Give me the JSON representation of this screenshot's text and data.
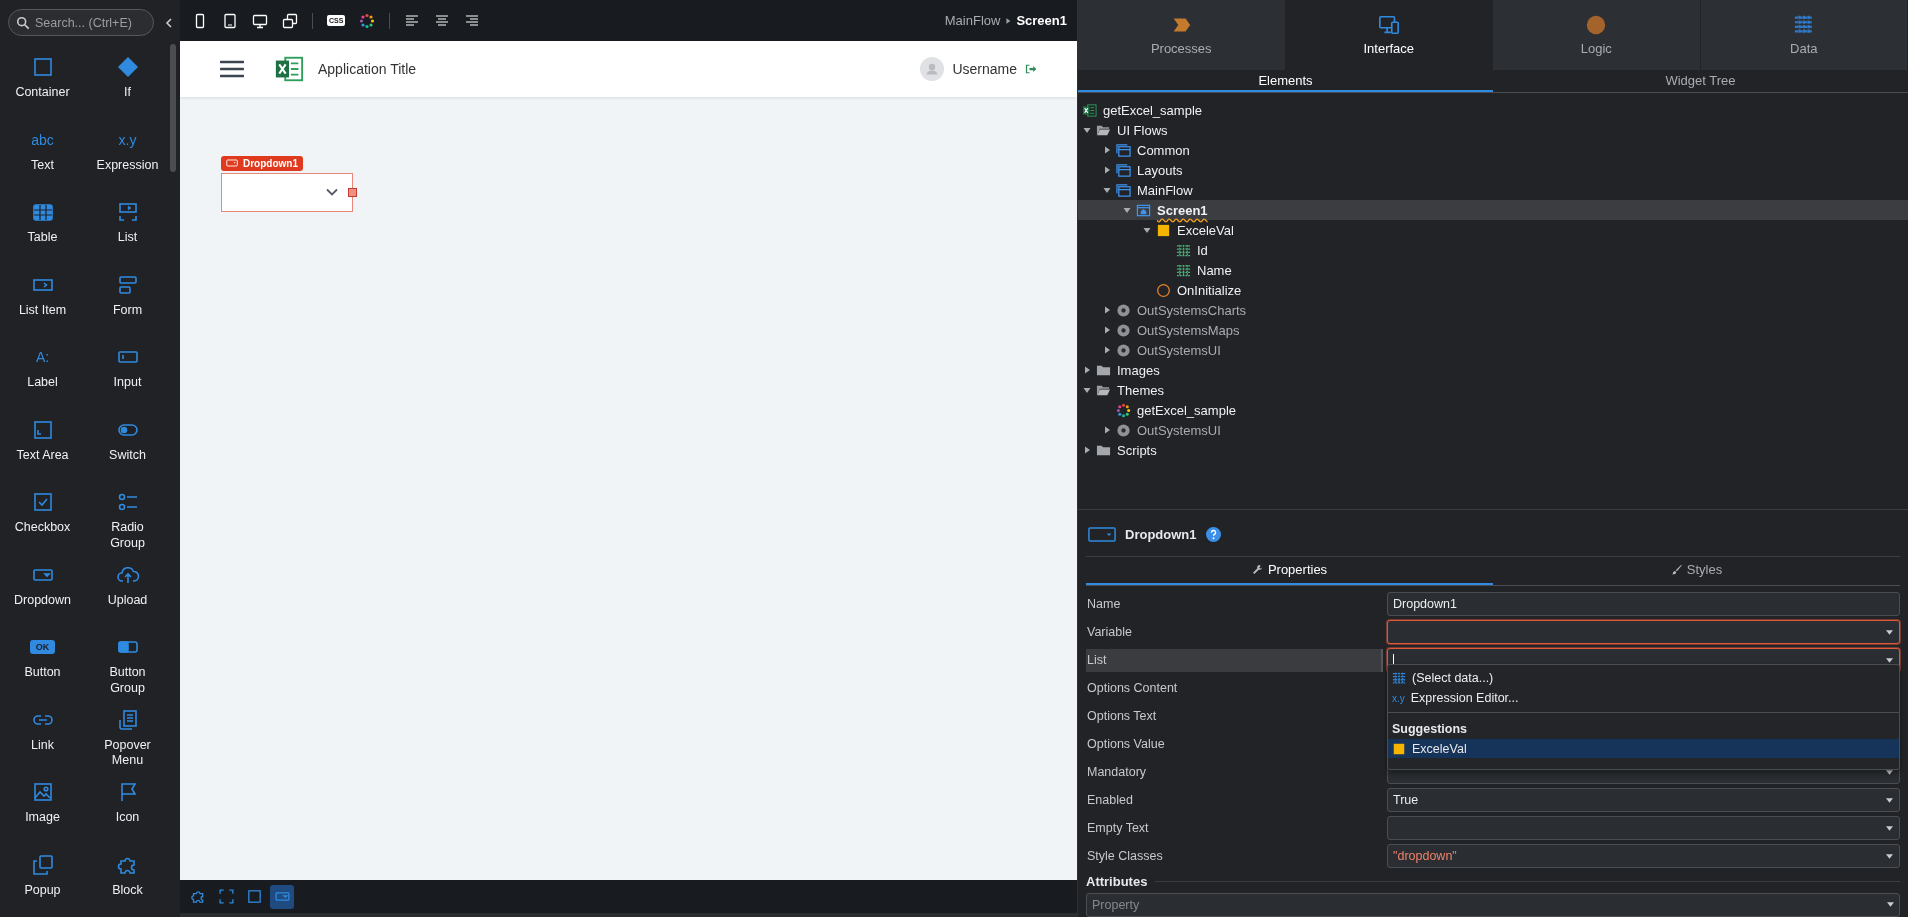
{
  "toolbox": {
    "search": {
      "placeholder": "Search... (Ctrl+E)"
    },
    "items": [
      {
        "kind": "container",
        "label": "Container"
      },
      {
        "kind": "if",
        "label": "If"
      },
      {
        "kind": "glyph",
        "glyph": "abc",
        "label": "Text"
      },
      {
        "kind": "glyph",
        "glyph": "x.y",
        "label": "Expression"
      },
      {
        "kind": "table",
        "label": "Table"
      },
      {
        "kind": "list",
        "label": "List"
      },
      {
        "kind": "list_item",
        "label": "List Item"
      },
      {
        "kind": "form",
        "label": "Form"
      },
      {
        "kind": "glyph",
        "glyph": "A:",
        "label": "Label"
      },
      {
        "kind": "input",
        "label": "Input"
      },
      {
        "kind": "text_area",
        "label": "Text Area"
      },
      {
        "kind": "switch",
        "label": "Switch"
      },
      {
        "kind": "checkbox",
        "label": "Checkbox"
      },
      {
        "kind": "radio_group",
        "label": "Radio Group"
      },
      {
        "kind": "dropdown",
        "label": "Dropdown"
      },
      {
        "kind": "upload",
        "label": "Upload"
      },
      {
        "kind": "button",
        "glyph": "OK",
        "label": "Button"
      },
      {
        "kind": "button_group",
        "label": "Button Group"
      },
      {
        "kind": "link",
        "label": "Link"
      },
      {
        "kind": "popover_menu",
        "label": "Popover Menu"
      },
      {
        "kind": "image",
        "label": "Image"
      },
      {
        "kind": "icon",
        "label": "Icon"
      },
      {
        "kind": "popup",
        "label": "Popup"
      },
      {
        "kind": "block",
        "label": "Block"
      }
    ]
  },
  "canvas": {
    "toolbar": {
      "css_glyph": "CSS"
    },
    "breadcrumb": [
      "MainFlow",
      "Screen1"
    ],
    "app": {
      "title": "Application Title",
      "username": "Username",
      "widget_tag": "Dropdown1"
    },
    "bottom_tools": [
      {
        "selected": false
      },
      {
        "selected": false
      },
      {
        "selected": false
      },
      {
        "selected": true
      }
    ]
  },
  "tabs": [
    {
      "label": "Processes",
      "kind": "processes",
      "selected": false
    },
    {
      "label": "Interface",
      "kind": "interface",
      "selected": true
    },
    {
      "label": "Logic",
      "kind": "logic",
      "selected": false
    },
    {
      "label": "Data",
      "kind": "data",
      "selected": false
    }
  ],
  "subtabs": [
    {
      "label": "Elements",
      "selected": true
    },
    {
      "label": "Widget Tree",
      "selected": false
    }
  ],
  "tree": [
    {
      "label": "getExcel_sample",
      "kind": "module",
      "selected": false
    },
    {
      "label": "UI Flows",
      "kind": "folder",
      "expanded": true,
      "selected": false,
      "children": [
        {
          "label": "Common",
          "kind": "flow",
          "expanded": false,
          "selected": false
        },
        {
          "label": "Layouts",
          "kind": "flow",
          "expanded": false,
          "selected": false
        },
        {
          "label": "MainFlow",
          "kind": "flow",
          "expanded": true,
          "selected": false,
          "children": [
            {
              "label": "Screen1",
              "kind": "screen",
              "expanded": true,
              "selected": true,
              "warning": true,
              "children": [
                {
                  "label": "ExceleVal",
                  "kind": "variable",
                  "expanded": true,
                  "selected": false,
                  "children": [
                    {
                      "label": "Id",
                      "kind": "attribute",
                      "selected": false
                    },
                    {
                      "label": "Name",
                      "kind": "attribute",
                      "selected": false
                    }
                  ]
                },
                {
                  "label": "OnInitialize",
                  "kind": "action",
                  "selected": false
                }
              ]
            }
          ]
        },
        {
          "label": "OutSystemsCharts",
          "kind": "reference",
          "expanded": false,
          "selected": false
        },
        {
          "label": "OutSystemsMaps",
          "kind": "reference",
          "expanded": false,
          "selected": false
        },
        {
          "label": "OutSystemsUI",
          "kind": "reference",
          "expanded": false,
          "selected": false
        }
      ]
    },
    {
      "label": "Images",
      "kind": "folder",
      "expanded": false,
      "selected": false
    },
    {
      "label": "Themes",
      "kind": "folder",
      "expanded": true,
      "selected": false,
      "children": [
        {
          "label": "getExcel_sample",
          "kind": "theme",
          "selected": false
        },
        {
          "label": "OutSystemsUI",
          "kind": "reference",
          "expanded": false,
          "selected": false
        }
      ]
    },
    {
      "label": "Scripts",
      "kind": "folder",
      "expanded": false,
      "selected": false
    }
  ],
  "properties": {
    "title": "Dropdown1",
    "tabs": [
      {
        "label": "Properties",
        "kind": "wrench",
        "selected": true
      },
      {
        "label": "Styles",
        "kind": "brush",
        "selected": false
      }
    ],
    "rows": [
      {
        "label": "Name",
        "kind": "text",
        "value": "Dropdown1",
        "error": false,
        "selected": false
      },
      {
        "label": "Variable",
        "kind": "select",
        "error": true,
        "selected": false
      },
      {
        "label": "List",
        "kind": "select",
        "error": true,
        "selected": true,
        "editing": true
      },
      {
        "label": "Options Content",
        "kind": "covered",
        "selected": false
      },
      {
        "label": "Options Text",
        "kind": "covered",
        "selected": false
      },
      {
        "label": "Options Value",
        "kind": "covered",
        "selected": false
      },
      {
        "label": "Mandatory",
        "kind": "select",
        "error": false,
        "selected": false
      },
      {
        "label": "Enabled",
        "kind": "select",
        "value": "True",
        "error": false,
        "selected": false
      },
      {
        "label": "Empty Text",
        "kind": "select",
        "error": false,
        "selected": false
      },
      {
        "label": "Style Classes",
        "kind": "literal",
        "value": "\"dropdown\"",
        "error": false,
        "selected": false
      }
    ],
    "popup": {
      "actions": [
        {
          "label": "(Select data...)",
          "kind": "select_data"
        },
        {
          "label": "Expression Editor...",
          "kind": "expression",
          "glyph": "x.y"
        }
      ],
      "section": "Suggestions",
      "suggestions": [
        {
          "label": "ExceleVal",
          "selected": true
        }
      ]
    },
    "attributes": {
      "title": "Attributes",
      "placeholder": "Property"
    }
  }
}
